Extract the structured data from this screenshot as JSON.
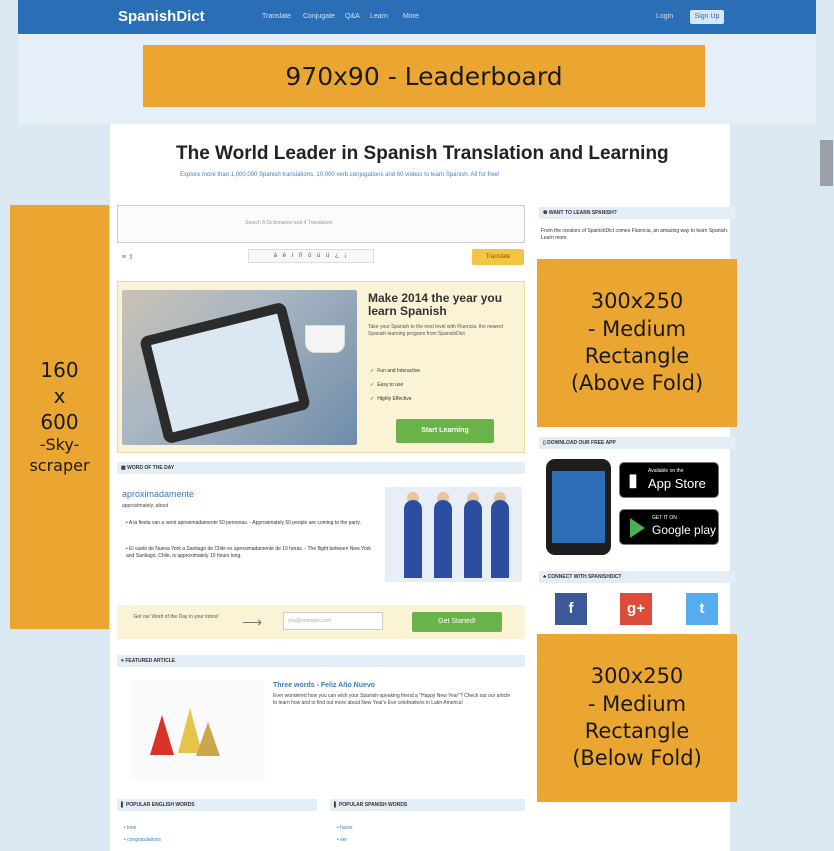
{
  "nav": {
    "logo": "SpanishDict",
    "links": [
      "Translate",
      "Conjugate",
      "Q&A",
      "Learn",
      "More"
    ],
    "login": "Login",
    "signup": "Sign Up"
  },
  "ads": {
    "leaderboard": "970x90 - Leaderboard",
    "skyscraper_lines": [
      "160",
      "x",
      "600",
      "-Sky-",
      "scraper"
    ],
    "rect_above_lines": [
      "300x250",
      "- Medium",
      "Rectangle",
      "(Above Fold)"
    ],
    "rect_below_lines": [
      "300x250",
      "- Medium",
      "Rectangle",
      "(Below Fold)"
    ]
  },
  "headline": "The World Leader in Spanish Translation and Learning",
  "subhead": "Explore more than 1,000,000 Spanish translations, 10,000 verb conjugations and 60 videos to learn Spanish. All for free!",
  "search": {
    "placeholder": "Search 8 Dictionaries and 4 Translators",
    "icons": "≡  ⇪",
    "accents": "á é í ñ ó ú ü ¿ ¡",
    "translate_button": "Translate"
  },
  "promo": {
    "title": "Make 2014 the year you learn Spanish",
    "text": "Take your Spanish to the next level with Fluencia, the newest Spanish learning program from SpanishDict.",
    "checks": [
      "Fun and Interactive",
      "Easy to use",
      "Highly Effective"
    ],
    "button": "Start Learning"
  },
  "wotd": {
    "heading": "WORD OF THE DAY",
    "word": "aproximadamente",
    "translation": "approximately, about",
    "examples": [
      "A la fiesta van a venir aproximadamente 50 personas. - Approximately 50 people are coming to the party.",
      "El vuelo de Nueva York a Santiago de Chile es aproximadamente de 10 horas. - The flight between New York and Santiago, Chile, is approximately 10 hours long."
    ]
  },
  "newsletter": {
    "text": "Get our Word of the Day in your inbox!",
    "placeholder": "you@example.com",
    "button": "Get Started!"
  },
  "featured": {
    "heading": "FEATURED ARTICLE",
    "title": "Three words - Feliz Año Nuevo",
    "text": "Ever wondered how you can wish your Spanish-speaking friend a \"Happy New Year\"? Check out our article to learn how and to find out more about New Year's Eve celebrations in Latin America!"
  },
  "popular": {
    "english_heading": "POPULAR ENGLISH WORDS",
    "spanish_heading": "POPULAR SPANISH WORDS",
    "english_items": [
      "love",
      "congratulations"
    ],
    "spanish_items": [
      "hacer",
      "ser"
    ]
  },
  "sidebar": {
    "learn_heading": "WANT TO LEARN SPANISH?",
    "learn_text": "From the creators of SpanishDict comes Fluencia, an amazing way to learn Spanish. Learn more",
    "app_heading": "DOWNLOAD OUR FREE APP",
    "appstore_small": "Available on the",
    "appstore_big": "App Store",
    "googleplay_small": "GET IT ON",
    "googleplay_big": "Google play",
    "connect_heading": "CONNECT WITH SPANISHDICT",
    "social": [
      "f",
      "g+",
      "t"
    ]
  },
  "colors": {
    "ad_orange": "#eba631",
    "nav_blue": "#2a6fb5",
    "background": "#dbe9f5",
    "facebook": "#3b5998",
    "google": "#dd4b39",
    "twitter": "#55acee"
  }
}
